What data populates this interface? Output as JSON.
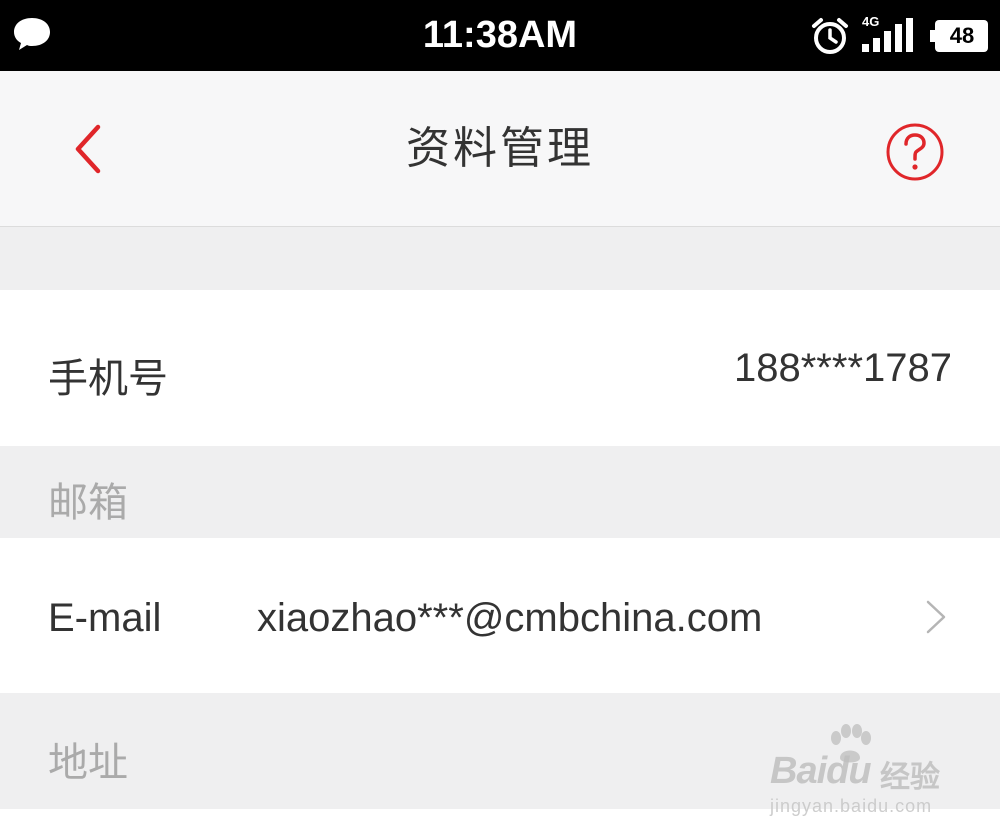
{
  "status_bar": {
    "time": "11:38AM",
    "network": "4G",
    "battery": "48",
    "icons": [
      "message-icon",
      "alarm-icon",
      "signal-icon",
      "battery-icon"
    ]
  },
  "nav": {
    "title": "资料管理",
    "back_icon": "chevron-left-icon",
    "help_icon": "question-circle-icon",
    "accent_color": "#e0262a"
  },
  "phone": {
    "label": "手机号",
    "value": "188****1787"
  },
  "email_section": {
    "header": "邮箱",
    "label": "E-mail",
    "value": "xiaozhao***@cmbchina.com",
    "chevron_icon": "chevron-right-icon"
  },
  "address_section": {
    "header": "地址"
  },
  "watermark": {
    "logo": "Baidu",
    "brand": "经验",
    "url": "jingyan.baidu.com"
  }
}
